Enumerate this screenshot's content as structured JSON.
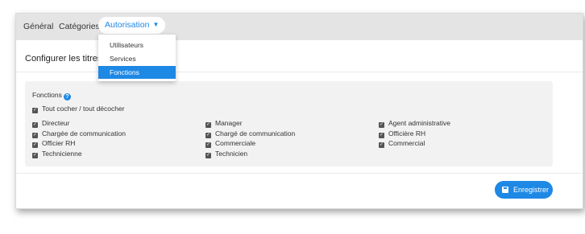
{
  "tabs": [
    {
      "label": "Général"
    },
    {
      "label": "Catégories"
    },
    {
      "label": "Autorisation"
    }
  ],
  "dropdown": {
    "items": [
      {
        "label": "Utilisateurs"
      },
      {
        "label": "Services"
      },
      {
        "label": "Fonctions"
      }
    ],
    "selected": "Fonctions"
  },
  "header": {
    "text": "Configurer les titres-r"
  },
  "section": {
    "title": "Fonctions",
    "help_icon": "help-icon",
    "toggle_all": "Tout cocher / tout décocher",
    "columns": [
      [
        "Directeur",
        "Chargée de communication",
        "Officier RH",
        "Technicienne"
      ],
      [
        "Manager",
        "Chargé de communication",
        "Commerciale",
        "Technicien"
      ],
      [
        "Agent administrative",
        "Officière RH",
        "Commercial"
      ]
    ]
  },
  "save_button": {
    "label": "Enregistrer",
    "icon": "save-icon"
  },
  "colors": {
    "accent": "#1e88e5",
    "tabbar": "#e4e4e4",
    "panel": "#f2f2f2"
  }
}
